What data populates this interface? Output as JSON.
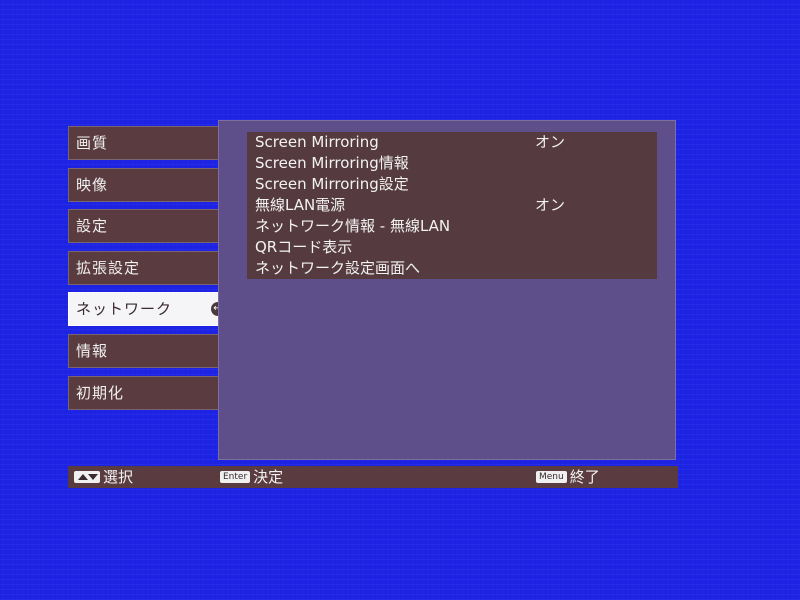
{
  "main_menu": {
    "items": [
      {
        "label": "画質"
      },
      {
        "label": "映像"
      },
      {
        "label": "設定"
      },
      {
        "label": "拡張設定"
      },
      {
        "label": "ネットワーク"
      },
      {
        "label": "情報"
      },
      {
        "label": "初期化"
      }
    ],
    "selected_index": 4
  },
  "submenu": {
    "items": [
      {
        "label": "Screen Mirroring",
        "value": "オン"
      },
      {
        "label": "Screen Mirroring情報",
        "value": ""
      },
      {
        "label": "Screen Mirroring設定",
        "value": ""
      },
      {
        "label": "無線LAN電源",
        "value": "オン"
      },
      {
        "label": "ネットワーク情報 - 無線LAN",
        "value": ""
      },
      {
        "label": "QRコード表示",
        "value": ""
      },
      {
        "label": "ネットワーク設定画面へ",
        "value": ""
      }
    ]
  },
  "footer": {
    "select_label": "選択",
    "enter_key": "Enter",
    "enter_label": "決定",
    "menu_key": "Menu",
    "menu_label": "終了"
  },
  "colors": {
    "background": "#1e24e6",
    "menu_item": "#5a3c40",
    "submenu_panel": "#5e4f8a",
    "selected_item": "#f5f5f7"
  },
  "icons": {
    "selected_indicator": "enter-arrow-icon",
    "select_key": "up-down-arrows-icon"
  }
}
